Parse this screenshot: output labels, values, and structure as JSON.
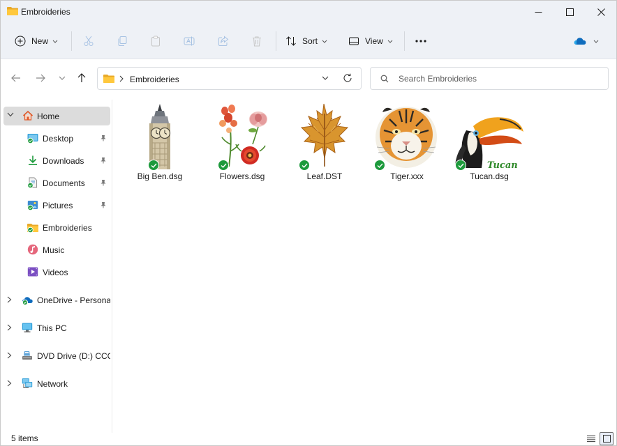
{
  "window": {
    "title": "Embroideries"
  },
  "toolbar": {
    "new_label": "New",
    "sort_label": "Sort",
    "view_label": "View",
    "more_label": "···"
  },
  "address": {
    "crumb": "Embroideries"
  },
  "search": {
    "placeholder": "Search Embroideries",
    "value": ""
  },
  "sidebar": {
    "items": [
      {
        "label": "Home"
      },
      {
        "label": "Desktop"
      },
      {
        "label": "Downloads"
      },
      {
        "label": "Documents"
      },
      {
        "label": "Pictures"
      },
      {
        "label": "Embroideries"
      },
      {
        "label": "Music"
      },
      {
        "label": "Videos"
      },
      {
        "label": "OneDrive - Personal"
      },
      {
        "label": "This PC"
      },
      {
        "label": "DVD Drive (D:) CCCOMA"
      },
      {
        "label": "Network"
      }
    ]
  },
  "files": [
    {
      "name": "Big Ben.dsg"
    },
    {
      "name": "Flowers.dsg"
    },
    {
      "name": "Leaf.DST"
    },
    {
      "name": "Tiger.xxx"
    },
    {
      "name": "Tucan.dsg"
    }
  ],
  "thumbnail_text": {
    "tucan_stitch": "Tucan"
  },
  "status": {
    "item_count": "5 items"
  },
  "colors": {
    "accent": "#0067c0",
    "sync_check": "#1d9a3c",
    "folder": "#f2c14e",
    "chrome": "#eef1f6"
  }
}
